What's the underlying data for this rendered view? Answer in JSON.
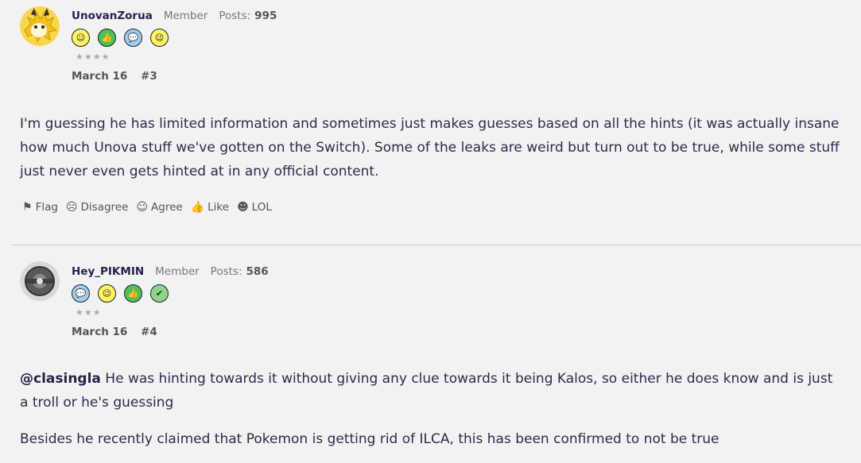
{
  "posts": [
    {
      "username": "UnovanZorua",
      "role": "Member",
      "posts_label": "Posts:",
      "posts_count": "995",
      "badges": [
        "smile-badge",
        "thumbs-up-badge",
        "speech-bubble-badge",
        "wink-badge"
      ],
      "stars": "★★★★",
      "date": "March 16",
      "number": "#3",
      "body": [
        "I'm guessing he has limited information and sometimes just makes guesses based on all the hints (it was actually insane how much Unova stuff we've gotten on the Switch). Some of the leaks are weird but turn out to be true, while some stuff just never even gets hinted at in any official content."
      ],
      "actions": {
        "flag": "Flag",
        "disagree": "Disagree",
        "agree": "Agree",
        "like": "Like",
        "lol": "LOL"
      }
    },
    {
      "username": "Hey_PIKMIN",
      "role": "Member",
      "posts_label": "Posts:",
      "posts_count": "586",
      "badges": [
        "speech-bubble-badge",
        "wink-badge",
        "thumbs-up-badge",
        "check-badge"
      ],
      "stars": "★★★",
      "date": "March 16",
      "number": "#4",
      "mention": "@clasingla",
      "body": [
        " He was hinting towards it without giving any clue towards it being Kalos, so either he does know and is just a troll or he's guessing",
        "Besides he recently claimed that Pokemon is getting rid of ILCA, this has been confirmed to not be true"
      ]
    }
  ],
  "colors": {
    "background": "#f2f2f2",
    "username": "#26234a",
    "muted": "#777777",
    "divider": "#c9c9c9"
  }
}
